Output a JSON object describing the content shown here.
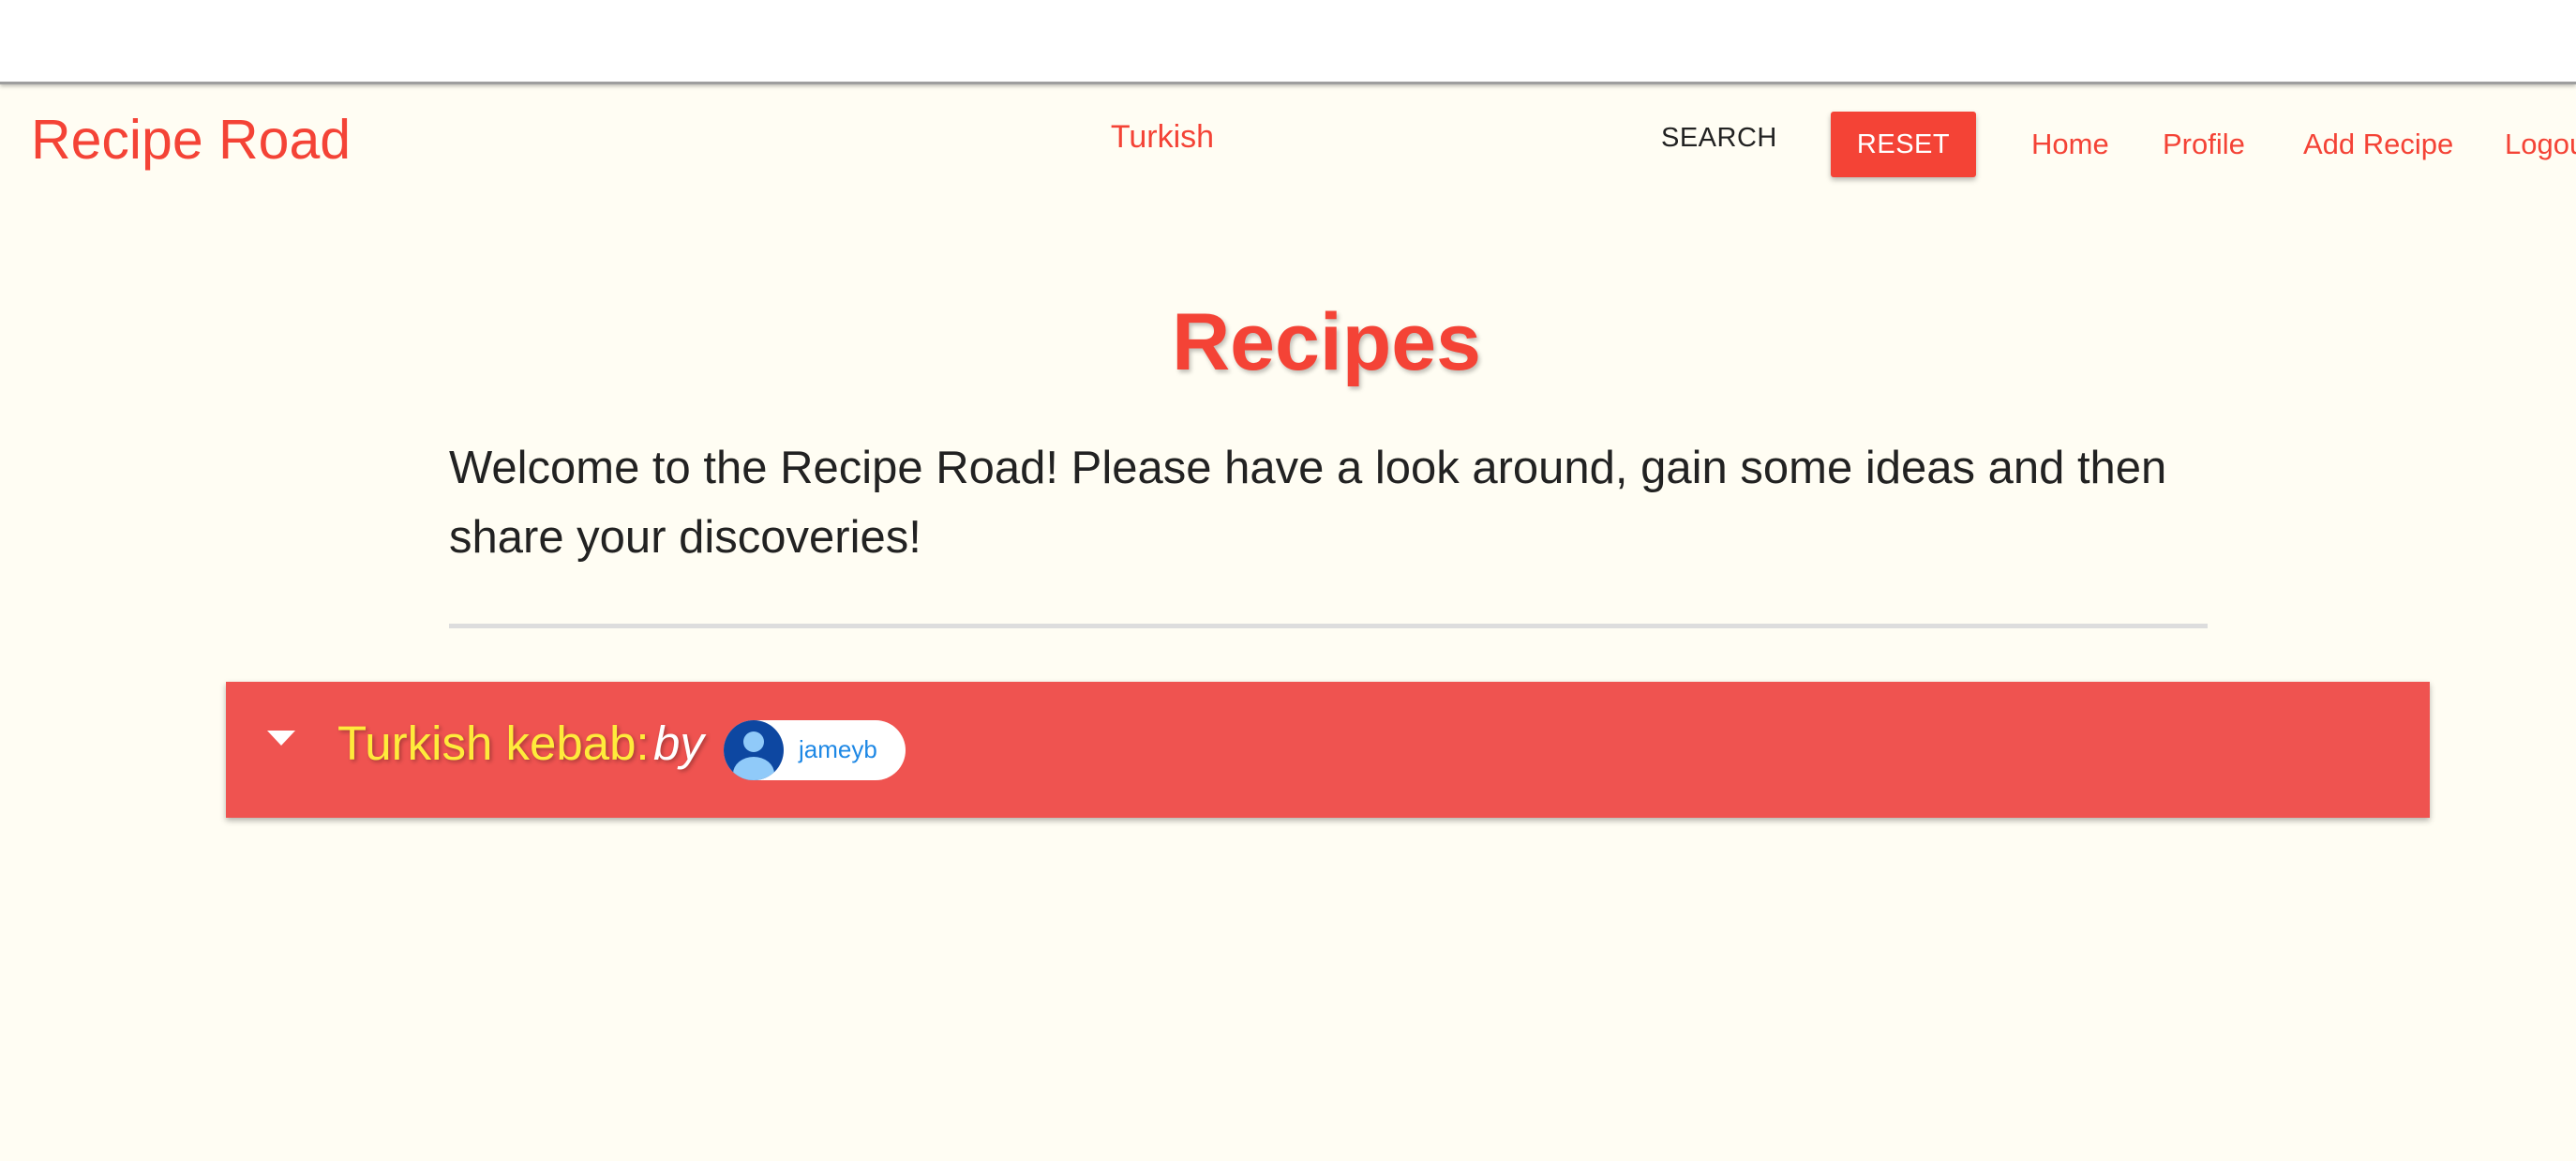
{
  "app": {
    "brand": "Recipe Road"
  },
  "navbar": {
    "search_value": "Turkish",
    "search_label": "SEARCH",
    "reset_label": "RESET",
    "links": {
      "home": "Home",
      "profile": "Profile",
      "add_recipe": "Add Recipe",
      "logout": "Logout"
    }
  },
  "main": {
    "title": "Recipes",
    "welcome": "Welcome to the Recipe Road! Please have a look around, gain some ideas and then share your discoveries!",
    "recipes": [
      {
        "title": "Turkish kebab:",
        "by_label": "by",
        "author": "jameyb",
        "expand_icon": "caret-down-icon",
        "avatar_icon": "user-avatar-icon"
      }
    ]
  },
  "colors": {
    "accent": "#f44336",
    "card_background": "#ef5350",
    "recipe_title": "#ffeb3b",
    "page_background": "#fffdf3",
    "author_link": "#1e88e5"
  }
}
